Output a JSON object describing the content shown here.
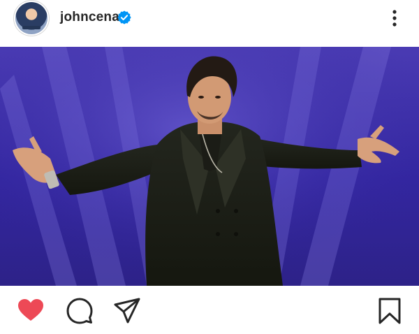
{
  "post": {
    "username": "johncena",
    "verified": true,
    "avatar_icon": "profile-avatar",
    "more_icon": "more-vertical-icon",
    "liked": true,
    "colors": {
      "like": "#ed4956",
      "verified": "#0095f6",
      "text": "#262626",
      "backdrop": "#3b2fa0"
    }
  },
  "actions": {
    "like_icon": "heart-icon",
    "comment_icon": "comment-icon",
    "share_icon": "send-icon",
    "save_icon": "bookmark-icon"
  }
}
